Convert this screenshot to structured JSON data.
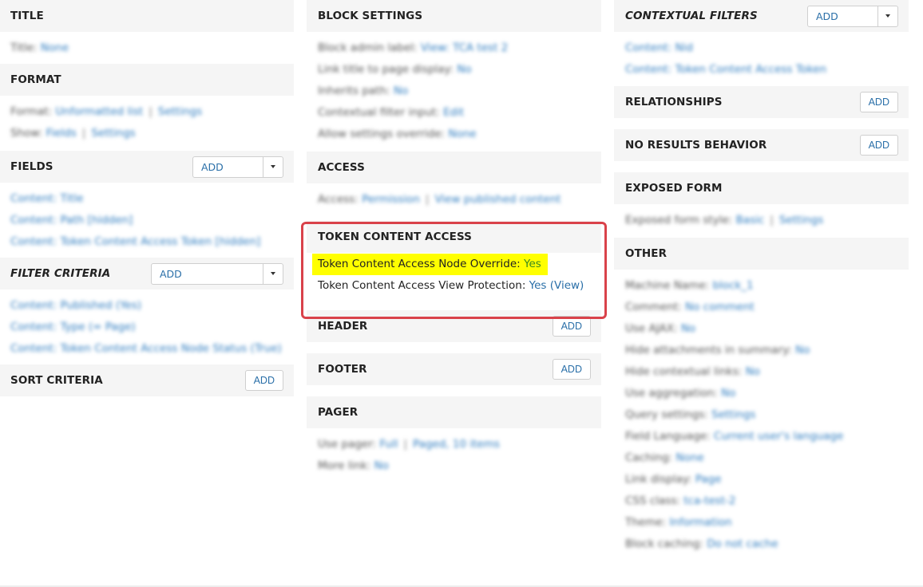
{
  "col1": {
    "title_section": {
      "header": "TITLE",
      "rows": [
        {
          "label": "Title:",
          "value": "None"
        }
      ]
    },
    "format_section": {
      "header": "FORMAT",
      "format_label": "Format:",
      "format_value": "Unformatted list",
      "format_settings": "Settings",
      "show_label": "Show:",
      "show_value": "Fields",
      "show_settings": "Settings"
    },
    "fields_section": {
      "header": "FIELDS",
      "add": "ADD",
      "items": [
        "Content: Title",
        "Content: Path [hidden]",
        "Content: Token Content Access Token [hidden]"
      ]
    },
    "filter_section": {
      "header": "FILTER CRITERIA",
      "add": "ADD",
      "items": [
        "Content: Published (Yes)",
        "Content: Type (= Page)",
        "Content: Token Content Access Node Status (True)"
      ]
    },
    "sort_section": {
      "header": "SORT CRITERIA",
      "add": "ADD"
    }
  },
  "col2": {
    "block_settings": {
      "header": "BLOCK SETTINGS",
      "rows": [
        {
          "label": "Block admin label:",
          "value": "View: TCA test 2"
        },
        {
          "label": "Link title to page display:",
          "value": "No"
        },
        {
          "label": "Inherits path:",
          "value": "No"
        },
        {
          "label": "Contextual filter input:",
          "value": "Edit"
        },
        {
          "label": "Allow settings override:",
          "value": "None"
        }
      ]
    },
    "access": {
      "header": "ACCESS",
      "label": "Access:",
      "value": "Permission",
      "value2": "View published content"
    },
    "token_content_access": {
      "header": "TOKEN CONTENT ACCESS",
      "node_override_label": "Token Content Access Node Override:",
      "node_override_value": "Yes",
      "view_protection_label": "Token Content Access View Protection:",
      "view_protection_value": "Yes (View)"
    },
    "header_section": {
      "header": "HEADER",
      "add": "ADD"
    },
    "footer_section": {
      "header": "FOOTER",
      "add": "ADD"
    },
    "pager": {
      "header": "PAGER",
      "use_pager_label": "Use pager:",
      "use_pager_value": "Full",
      "use_pager_value2": "Paged, 10 items",
      "more_link_label": "More link:",
      "more_link_value": "No"
    }
  },
  "col3": {
    "contextual_filters": {
      "header": "CONTEXTUAL FILTERS",
      "add": "ADD",
      "items": [
        "Content: Nid",
        "Content: Token Content Access Token"
      ]
    },
    "relationships": {
      "header": "RELATIONSHIPS",
      "add": "ADD"
    },
    "no_results": {
      "header": "NO RESULTS BEHAVIOR",
      "add": "ADD"
    },
    "exposed_form": {
      "header": "EXPOSED FORM",
      "label": "Exposed form style:",
      "value": "Basic",
      "value2": "Settings"
    },
    "other": {
      "header": "OTHER",
      "rows": [
        {
          "label": "Machine Name:",
          "value": "block_1"
        },
        {
          "label": "Comment:",
          "value": "No comment"
        },
        {
          "label": "Use AJAX:",
          "value": "No"
        },
        {
          "label": "Hide attachments in summary:",
          "value": "No"
        },
        {
          "label": "Hide contextual links:",
          "value": "No"
        },
        {
          "label": "Use aggregation:",
          "value": "No"
        },
        {
          "label": "Query settings:",
          "value": "Settings"
        },
        {
          "label": "Field Language:",
          "value": "Current user's language"
        },
        {
          "label": "Caching:",
          "value": "None"
        },
        {
          "label": "Link display:",
          "value": "Page"
        },
        {
          "label": "CSS class:",
          "value": "tca-test-2"
        },
        {
          "label": "Theme:",
          "value": "Information"
        },
        {
          "label": "Block caching:",
          "value": "Do not cache"
        }
      ]
    }
  }
}
